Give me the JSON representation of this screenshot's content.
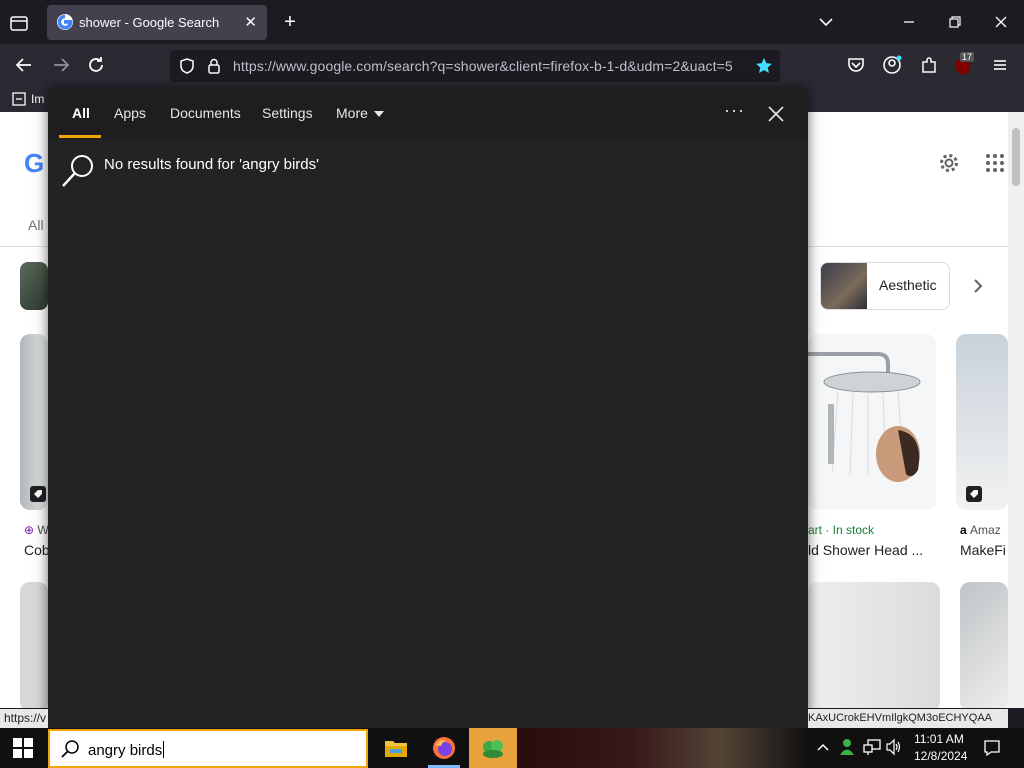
{
  "browser": {
    "tab_title": "shower - Google Search",
    "url": "https://www.google.com/search?q=shower&client=firefox-b-1-d&udm=2&uact=5",
    "bookmark_label": "Im",
    "extension_badge": "17"
  },
  "google": {
    "all_tab": "All",
    "chip_label": "Aesthetic",
    "results": [
      {
        "source": "W",
        "title": "Cob"
      },
      {
        "source": "art · In stock",
        "title": "ld Shower Head ..."
      },
      {
        "source": "Amaz",
        "title": "MakeFi"
      }
    ]
  },
  "search_flyout": {
    "tabs": [
      "All",
      "Apps",
      "Documents",
      "Settings",
      "More"
    ],
    "active_tab": "All",
    "no_results": "No results found for 'angry birds'"
  },
  "statusbar": {
    "left": "https://v",
    "right": "KAxUCrokEHVmIlgkQM3oECHYQAA"
  },
  "taskbar": {
    "search_text": "angry birds",
    "time": "11:01 AM",
    "date": "12/8/2024"
  },
  "colors": {
    "accent": "#f0a30a",
    "flyout_bg": "#232323",
    "firefox_tabbar": "#1c1b22",
    "firefox_navbar": "#2b2a33"
  }
}
